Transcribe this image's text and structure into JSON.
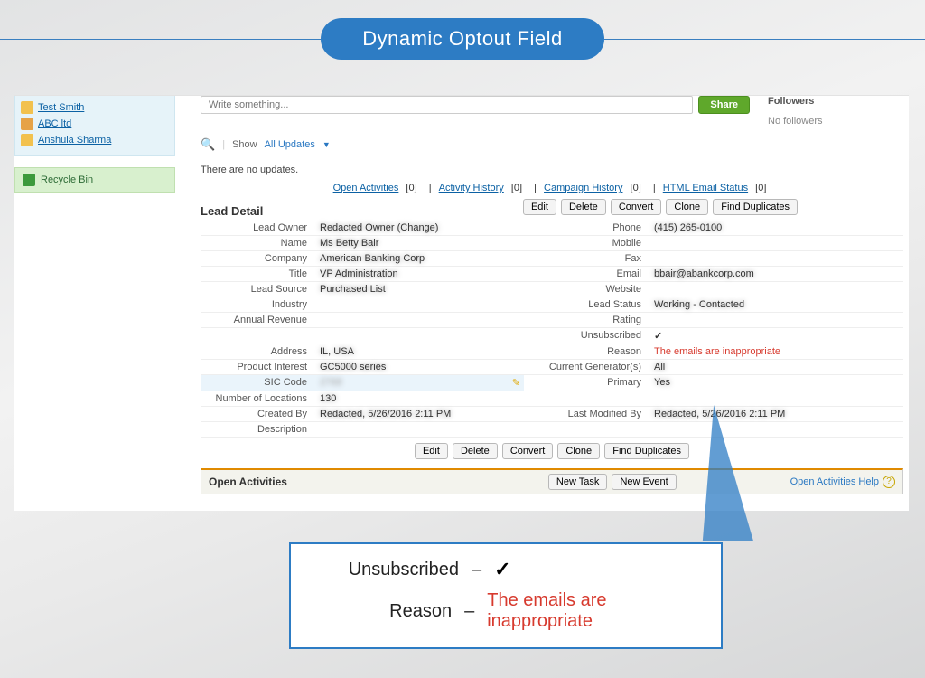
{
  "banner": {
    "title": "Dynamic Optout Field"
  },
  "sidebar": {
    "recent": [
      {
        "label": "Test Smith"
      },
      {
        "label": "ABC ltd"
      },
      {
        "label": "Anshula Sharma"
      }
    ],
    "recycle_label": "Recycle Bin"
  },
  "feed": {
    "placeholder": "Write something...",
    "share_label": "Share",
    "followers_head": "Followers",
    "followers_sub": "No followers",
    "show_label": "Show",
    "show_value": "All Updates",
    "no_updates": "There are no updates."
  },
  "rel_links": {
    "open_activities": "Open Activities",
    "activity_history": "Activity History",
    "campaign_history": "Campaign History",
    "html_email_status": "HTML Email Status",
    "count": "[0]"
  },
  "buttons": {
    "edit": "Edit",
    "delete": "Delete",
    "convert": "Convert",
    "clone": "Clone",
    "find_dup": "Find Duplicates",
    "new_task": "New Task",
    "new_event": "New Event"
  },
  "lead": {
    "section_title": "Lead Detail",
    "labels": {
      "lead_owner": "Lead Owner",
      "name": "Name",
      "company": "Company",
      "title": "Title",
      "lead_source": "Lead Source",
      "industry": "Industry",
      "annual_revenue": "Annual Revenue",
      "address": "Address",
      "product_interest": "Product Interest",
      "sic_code": "SIC Code",
      "num_locations": "Number of Locations",
      "created_by": "Created By",
      "description": "Description",
      "phone": "Phone",
      "mobile": "Mobile",
      "fax": "Fax",
      "email": "Email",
      "website": "Website",
      "lead_status": "Lead Status",
      "rating": "Rating",
      "unsubscribed": "Unsubscribed",
      "reason": "Reason",
      "current_generators": "Current Generator(s)",
      "primary": "Primary",
      "last_modified_by": "Last Modified By"
    },
    "values": {
      "lead_owner": "Redacted Owner (Change)",
      "name": "Ms Betty Bair",
      "company": "American Banking Corp",
      "title": "VP Administration",
      "lead_source": "Purchased List",
      "address": "IL, USA",
      "product_interest": "GC5000 series",
      "sic_code": "2768",
      "num_locations": "130",
      "created_by": "Redacted, 5/26/2016 2:11 PM",
      "phone": "(415) 265-0100",
      "email": "bbair@abankcorp.com",
      "lead_status": "Working - Contacted",
      "unsubscribed": "✓",
      "reason": "The emails are inappropriate",
      "current_generators": "All",
      "primary": "Yes",
      "last_modified_by": "Redacted, 5/26/2016 2:11 PM"
    }
  },
  "open_activities": {
    "title": "Open Activities",
    "help": "Open Activities Help"
  },
  "callout": {
    "unsubscribed_label": "Unsubscribed",
    "unsubscribed_value": "✓",
    "reason_label": "Reason",
    "reason_value": "The emails are inappropriate"
  }
}
